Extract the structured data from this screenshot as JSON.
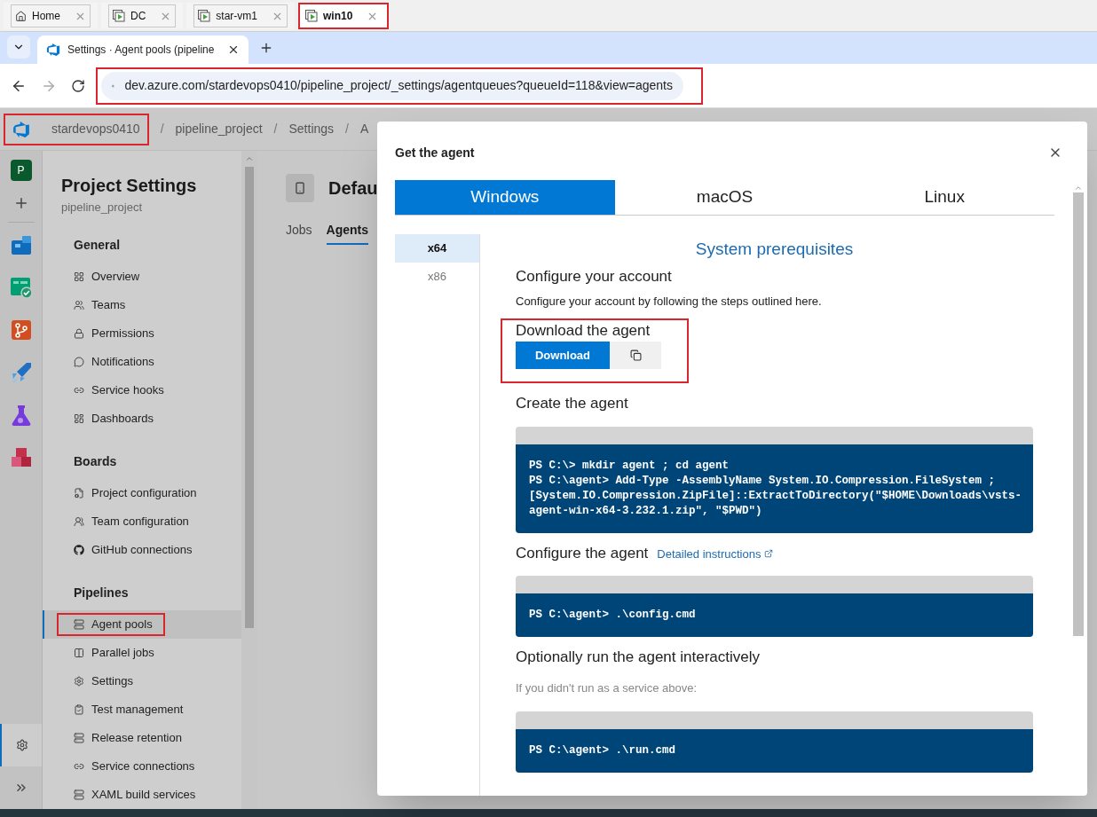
{
  "vm_tabs": [
    {
      "label": "Home",
      "kind": "home",
      "selected": false,
      "highlighted": false
    },
    {
      "label": "DC",
      "kind": "vm",
      "selected": false,
      "highlighted": false
    },
    {
      "label": "star-vm1",
      "kind": "vm",
      "selected": false,
      "highlighted": false
    },
    {
      "label": "win10",
      "kind": "vm",
      "selected": true,
      "highlighted": true
    }
  ],
  "browser_tab": {
    "title": "Settings · Agent pools (pipeline"
  },
  "address_bar": {
    "url": "dev.azure.com/stardevops0410/pipeline_project/_settings/agentqueues?queueId=118&view=agents",
    "highlighted": true
  },
  "header": {
    "separator": "/",
    "breadcrumbs": [
      {
        "label": "stardevops0410",
        "highlighted": true
      },
      {
        "label": "pipeline_project",
        "highlighted": false
      },
      {
        "label": "Settings",
        "highlighted": false
      },
      {
        "label": "A",
        "highlighted": false
      }
    ]
  },
  "rail": {
    "avatar": "P",
    "apps": [
      {
        "kind": "overview"
      },
      {
        "kind": "boards"
      },
      {
        "kind": "repos"
      },
      {
        "kind": "pipelines"
      },
      {
        "kind": "test_plans"
      },
      {
        "kind": "artifacts"
      }
    ],
    "settings_selected": true
  },
  "sidebar": {
    "title": "Project Settings",
    "subtitle": "pipeline_project",
    "sections": [
      {
        "heading": "General",
        "items": [
          {
            "label": "Overview",
            "selected": false,
            "highlighted": false
          },
          {
            "label": "Teams",
            "selected": false,
            "highlighted": false
          },
          {
            "label": "Permissions",
            "selected": false,
            "highlighted": false
          },
          {
            "label": "Notifications",
            "selected": false,
            "highlighted": false
          },
          {
            "label": "Service hooks",
            "selected": false,
            "highlighted": false
          },
          {
            "label": "Dashboards",
            "selected": false,
            "highlighted": false
          }
        ]
      },
      {
        "heading": "Boards",
        "items": [
          {
            "label": "Project configuration",
            "selected": false,
            "highlighted": false
          },
          {
            "label": "Team configuration",
            "selected": false,
            "highlighted": false
          },
          {
            "label": "GitHub connections",
            "selected": false,
            "highlighted": false
          }
        ]
      },
      {
        "heading": "Pipelines",
        "items": [
          {
            "label": "Agent pools",
            "selected": true,
            "highlighted": true
          },
          {
            "label": "Parallel jobs",
            "selected": false,
            "highlighted": false
          },
          {
            "label": "Settings",
            "selected": false,
            "highlighted": false
          },
          {
            "label": "Test management",
            "selected": false,
            "highlighted": false
          },
          {
            "label": "Release retention",
            "selected": false,
            "highlighted": false
          },
          {
            "label": "Service connections",
            "selected": false,
            "highlighted": false
          },
          {
            "label": "XAML build services",
            "selected": false,
            "highlighted": false
          }
        ]
      }
    ]
  },
  "page": {
    "title": "Defau",
    "tabs": [
      {
        "label": "Jobs",
        "selected": false
      },
      {
        "label": "Agents",
        "selected": true
      }
    ]
  },
  "dialog": {
    "title": "Get the agent",
    "os_tabs": [
      {
        "label": "Windows",
        "selected": true
      },
      {
        "label": "macOS",
        "selected": false
      },
      {
        "label": "Linux",
        "selected": false
      }
    ],
    "arch_tabs": [
      {
        "label": "x64",
        "selected": true
      },
      {
        "label": "x86",
        "selected": false
      }
    ],
    "prerequisites_link": "System prerequisites",
    "sections": [
      {
        "kind": "text",
        "heading": "Configure your account",
        "text": "Configure your account by following the steps outlined here."
      },
      {
        "kind": "download",
        "heading": "Download the agent",
        "button": "Download",
        "highlighted": true
      },
      {
        "kind": "code",
        "heading": "Create the agent",
        "code": [
          "PS C:\\> mkdir agent ; cd agent",
          "PS C:\\agent> Add-Type -AssemblyName System.IO.Compression.FileSystem ;",
          "[System.IO.Compression.ZipFile]::ExtractToDirectory(\"$HOME\\Downloads\\vsts-",
          "agent-win-x64-3.232.1.zip\", \"$PWD\")"
        ]
      },
      {
        "kind": "code",
        "heading": "Configure the agent",
        "link": "Detailed instructions",
        "code": [
          "PS C:\\agent> .\\config.cmd"
        ]
      },
      {
        "kind": "code",
        "heading": "Optionally run the agent interactively",
        "note": "If you didn't run as a service above:",
        "code": [
          "PS C:\\agent> .\\run.cmd"
        ]
      }
    ]
  }
}
